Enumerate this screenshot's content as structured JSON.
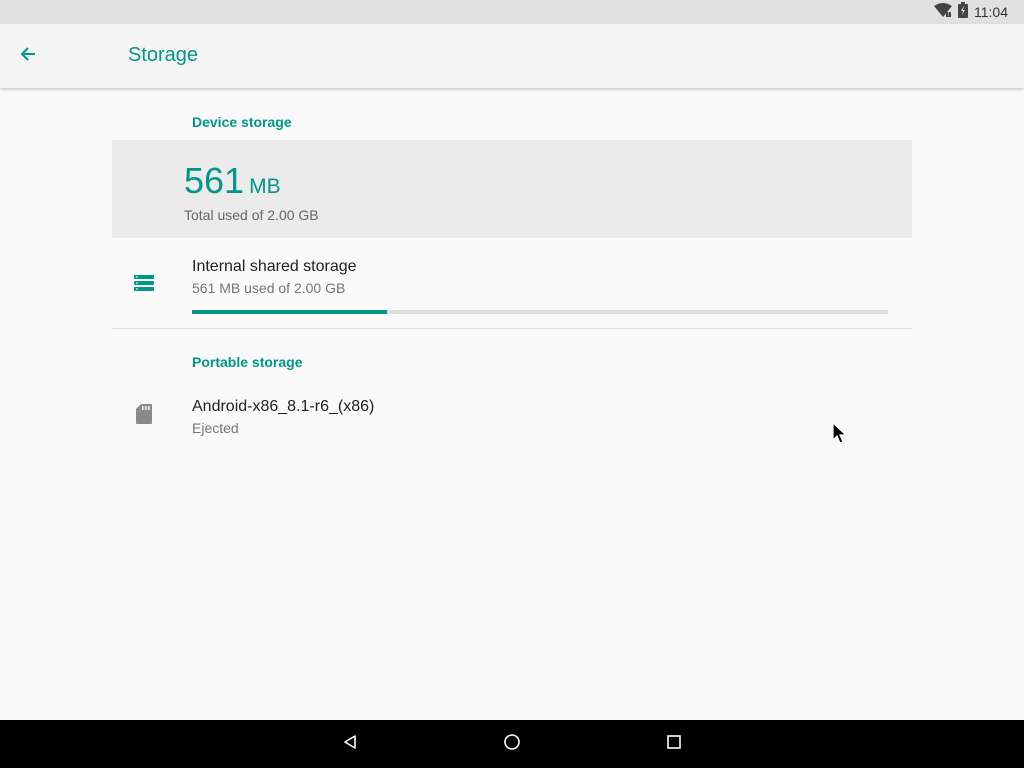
{
  "status_bar": {
    "time": "11:04",
    "icons": [
      "wifi-icon",
      "battery-icon"
    ]
  },
  "app_bar": {
    "back_icon": "arrow-back-icon",
    "title": "Storage"
  },
  "device_storage": {
    "header": "Device storage",
    "summary": {
      "value": "561",
      "unit": "MB",
      "caption": "Total used of 2.00 GB"
    },
    "internal": {
      "icon": "storage-icon",
      "title": "Internal shared storage",
      "subtitle": "561 MB used of 2.00 GB",
      "used_fraction": 0.28
    }
  },
  "portable_storage": {
    "header": "Portable storage",
    "items": [
      {
        "icon": "sd-card-icon",
        "title": "Android-x86_8.1-r6_(x86)",
        "subtitle": "Ejected"
      }
    ]
  },
  "nav_bar": {
    "buttons": [
      "back-triangle-icon",
      "home-circle-icon",
      "recents-square-icon"
    ]
  },
  "colors": {
    "accent": "#009688",
    "background": "#fafafa",
    "summary_card": "#ebebeb",
    "status_bar": "#e0e0e0",
    "nav_bar": "#000000"
  }
}
